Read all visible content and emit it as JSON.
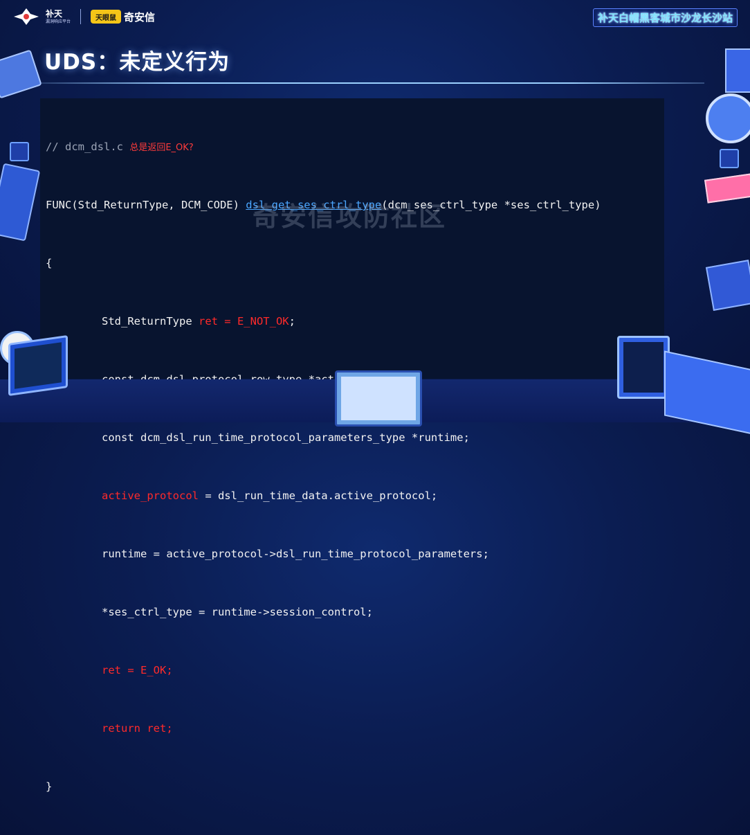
{
  "header": {
    "butian_name": "补天",
    "butian_sub": "漏洞响应平台",
    "qax_mascot": "天眼鼠",
    "qax_name": "奇安信",
    "event_title": "补天白帽黑客城市沙龙长沙站"
  },
  "slide": {
    "title": "UDS：未定义行为"
  },
  "code": {
    "comment": "// dcm_dsl.c",
    "comment_note": "总是返回E_OK?",
    "line2_prefix": "FUNC(Std_ReturnType, DCM_CODE) ",
    "line2_fn": "dsl_get_ses_ctrl_type",
    "line2_suffix": "(dcm_ses_ctrl_type *ses_ctrl_type)",
    "open_brace": "{",
    "line4_type": "Std_ReturnType ",
    "line4_red": "ret = E_NOT_OK",
    "line4_end": ";",
    "line5": "const dcm_dsl_protocol_row_type *active_protocol;",
    "line6": "const dcm_dsl_run_time_protocol_parameters_type *runtime;",
    "line7_red": "active_protocol",
    "line7_rest": " = dsl_run_time_data.active_protocol;",
    "line8": "runtime = active_protocol->dsl_run_time_protocol_parameters;",
    "line9": "*ses_ctrl_type = runtime->session_control;",
    "line10": "ret = E_OK;",
    "line11": "return ret;",
    "close_brace": "}"
  },
  "watermark": "奇安信攻防社区",
  "colors": {
    "background": "#0b1d52",
    "code_bg": "#08142f",
    "red": "#ff2a2a",
    "link": "#4aa6ff",
    "comment": "#9aa3b5"
  }
}
